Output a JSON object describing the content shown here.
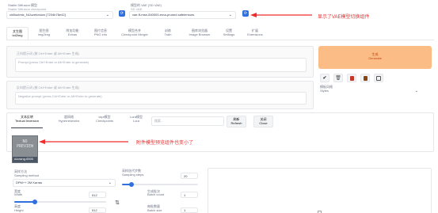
{
  "header": {
    "checkpoint_label": "Stable Diffusion 模型",
    "checkpoint_sublabel": "Stable Diffusion checkpoint",
    "checkpoint_value": "chilloutmix_NiJuzeforsion [7234b76e42]",
    "vae_label": "模型的 VAE (SD VAE)",
    "vae_sublabel": "SD VAE",
    "vae_value": "vae-ft-mse-840000-ema-pruned.safetensors",
    "annotation_vae": "显示了VAE模型切换组件"
  },
  "main_tabs": [
    {
      "cn": "文生图",
      "en": "txt2img"
    },
    {
      "cn": "图生图",
      "en": "img2img"
    },
    {
      "cn": "附加功能",
      "en": "Extras"
    },
    {
      "cn": "图片信息",
      "en": "PNG info"
    },
    {
      "cn": "模型合并",
      "en": "Checkpoint Merger"
    },
    {
      "cn": "训练",
      "en": "Train"
    },
    {
      "cn": "图库浏览器",
      "en": "Image Browser"
    },
    {
      "cn": "设置",
      "en": "Settings"
    },
    {
      "cn": "扩展",
      "en": "Extensions"
    }
  ],
  "prompt": {
    "label": "正向提示词 (按 Ctrl+Enter 或 Alt+Enter 生成)",
    "placeholder": "Prompt (press Ctrl+Enter or Alt+Enter to generate)"
  },
  "negative_prompt": {
    "label": "反向提示词 (按 Ctrl+Enter 或 Alt+Enter 生成)",
    "placeholder": "Negative prompt (press Ctrl+Enter or Alt+Enter to generate)"
  },
  "generate": {
    "cn": "生成",
    "en": "Generate"
  },
  "styles": {
    "label_cn": "模板风格",
    "label_en": "Styles"
  },
  "toolbar_icons": [
    "check-icon",
    "trash-icon",
    "red-card-icon",
    "clipboard-icon",
    "save-icon"
  ],
  "extra_tabs": [
    {
      "cn": "文本反转",
      "en": "Textual Inversion"
    },
    {
      "cn": "超网络",
      "en": "Hypernetworks"
    },
    {
      "cn": "ckpt模型",
      "en": "Checkpoints"
    },
    {
      "cn": "Lora模型",
      "en": "Lora"
    }
  ],
  "search_placeholder": "搜索...",
  "refresh": {
    "cn": "刷新",
    "en": "Refresh"
  },
  "close": {
    "cn": "关闭",
    "en": "Close"
  },
  "embedding_card": {
    "preview": "NO\nPREVIEW",
    "name": "ulzzang-6500"
  },
  "annotation_card": "附件模型预览组件也变小了",
  "sampling_method": {
    "label_cn": "采样方法",
    "label_en": "Sampling method",
    "value": "DPM++ 2M Karras"
  },
  "sampling_steps": {
    "label_cn": "采样迭代步数",
    "label_en": "Sampling steps",
    "value": "20",
    "fraction": 0.13
  },
  "width": {
    "label_cn": "宽度",
    "label_en": "Width",
    "value": "512",
    "fraction": 0.22
  },
  "height": {
    "label_cn": "高度",
    "label_en": "Height",
    "value": "512",
    "fraction": 0.22
  },
  "batch_count": {
    "label_cn": "生成批次",
    "label_en": "Batch count",
    "value": "1"
  },
  "batch_size": {
    "label_cn": "每批数量",
    "label_en": "Batch size",
    "value": "1"
  },
  "swap_icon": "swap-icon",
  "colors": {
    "accent": "#2f6fde",
    "generate_bg": "#fbbd85",
    "annotation": "#ef2b2b"
  }
}
